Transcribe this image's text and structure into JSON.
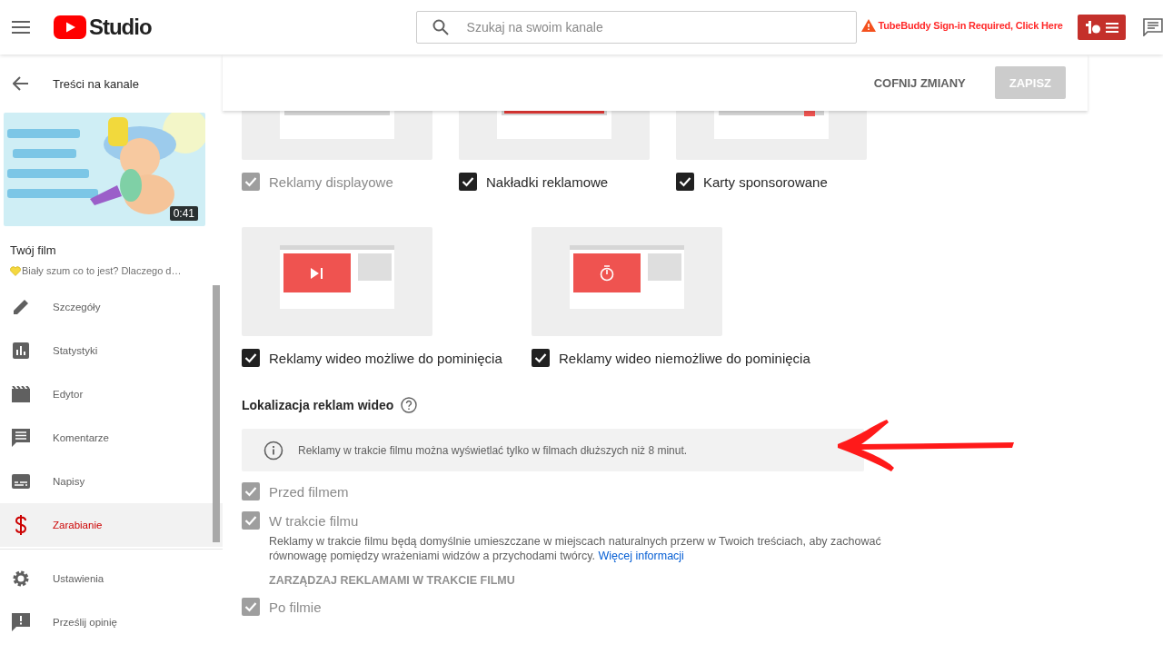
{
  "topbar": {
    "brand": "Studio",
    "search": {
      "placeholder": "Szukaj na swoim kanale"
    },
    "warning": "TubeBuddy Sign-in Required, Click Here"
  },
  "header": {
    "title": "Treści na kanale",
    "buttons": [
      {
        "label": "COFNIJ ZMIANY",
        "kind": "text",
        "disabled": false
      },
      {
        "label": "ZAPISZ",
        "kind": "filled",
        "disabled": true
      }
    ]
  },
  "video": {
    "duration": "0:41",
    "label": "Twój film",
    "title": "Biały szum co to jest? Dlaczego d…"
  },
  "nav": [
    {
      "label": "Szczegóły",
      "selected": false
    },
    {
      "label": "Statystyki",
      "selected": false
    },
    {
      "label": "Edytor",
      "selected": false
    },
    {
      "label": "Komentarze",
      "selected": false
    },
    {
      "label": "Napisy",
      "selected": false
    },
    {
      "label": "Zarabianie",
      "selected": true
    }
  ],
  "nav_bottom": [
    {
      "label": "Ustawienia"
    },
    {
      "label": "Prześlij opinię"
    }
  ],
  "ad_format_rows": [
    {
      "items": [
        {
          "kind": "display",
          "label": "Reklamy displayowe",
          "checked": true,
          "disabled": true
        },
        {
          "kind": "overlay",
          "label": "Nakładki reklamowe",
          "checked": true,
          "disabled": false
        },
        {
          "kind": "sponsored",
          "label": "Karty sponsorowane",
          "checked": true,
          "disabled": false
        }
      ]
    },
    {
      "items": [
        {
          "kind": "skippable",
          "label": "Reklamy wideo możliwe do pominięcia",
          "checked": true,
          "disabled": false
        },
        {
          "kind": "nonskippable",
          "label": "Reklamy wideo niemożliwe do pominięcia",
          "checked": true,
          "disabled": false
        }
      ]
    }
  ],
  "placement": {
    "heading": "Lokalizacja reklam wideo",
    "info": "Reklamy w trakcie filmu można wyświetlać tylko w filmach dłuższych niż 8 minut.",
    "options": [
      {
        "label": "Przed filmem",
        "checked": true,
        "disabled": true
      },
      {
        "label": "W trakcie filmu",
        "checked": true,
        "disabled": true,
        "description": "Reklamy w trakcie filmu będą domyślnie umieszczane w miejscach naturalnych przerw w Twoich treściach, aby zachować równowagę pomiędzy wrażeniami widzów a przychodami twórcy.",
        "link": "Więcej informacji",
        "action": "ZARZĄDZAJ REKLAMAMI W TRAKCIE FILMU"
      },
      {
        "label": "Po filmie",
        "checked": true,
        "disabled": true
      }
    ]
  }
}
